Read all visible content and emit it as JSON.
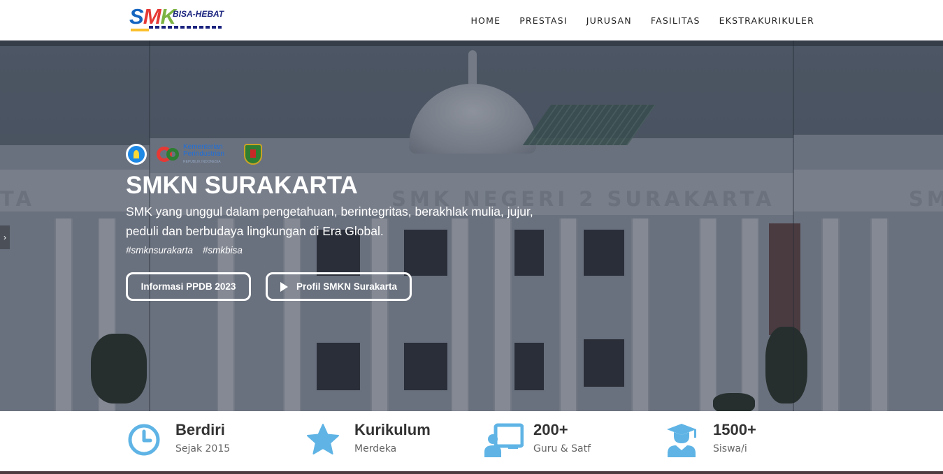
{
  "navbar": {
    "logo": {
      "main": "SMK",
      "badge": "BISA-HEBAT"
    },
    "menu": [
      {
        "label": "HOME"
      },
      {
        "label": "PRESTASI"
      },
      {
        "label": "JURUSAN"
      },
      {
        "label": "FASILITAS"
      },
      {
        "label": "EKSTRAKURIKULER"
      }
    ]
  },
  "hero": {
    "partners": {
      "kemenperin_line1": "Kementerian",
      "kemenperin_line2": "Perindustrian",
      "kemenperin_line3": "REPUBLIK INDONESIA"
    },
    "title": "SMKN SURAKARTA",
    "tagline": "SMK yang unggul dalam pengetahuan, berintegritas, berakhlak mulia, jujur, peduli dan berbudaya lingkungan di Era Global.",
    "tags": [
      "#smknsurakarta",
      "#smkbisa"
    ],
    "buttons": {
      "ppdb": "Informasi PPDB 2023",
      "profil": "Profil SMKN Surakarta"
    },
    "building_sign": "SMK NEGERI 2 SURAKARTA",
    "slider_arrow": "›"
  },
  "stats": [
    {
      "icon": "clock-icon",
      "title": "Berdiri",
      "sub": "Sejak 2015"
    },
    {
      "icon": "star-icon",
      "title": "Kurikulum",
      "sub": "Merdeka"
    },
    {
      "icon": "teacher-board-icon",
      "title": "200+",
      "sub": "Guru & Satf"
    },
    {
      "icon": "graduate-icon",
      "title": "1500+",
      "sub": "Siswa/i"
    }
  ],
  "colors": {
    "icon_blue": "#5fb4e5",
    "text_dark": "#333333",
    "text_muted": "#666666",
    "logo_blue": "#1565c0",
    "logo_red": "#e53935",
    "logo_green": "#7cb342"
  }
}
